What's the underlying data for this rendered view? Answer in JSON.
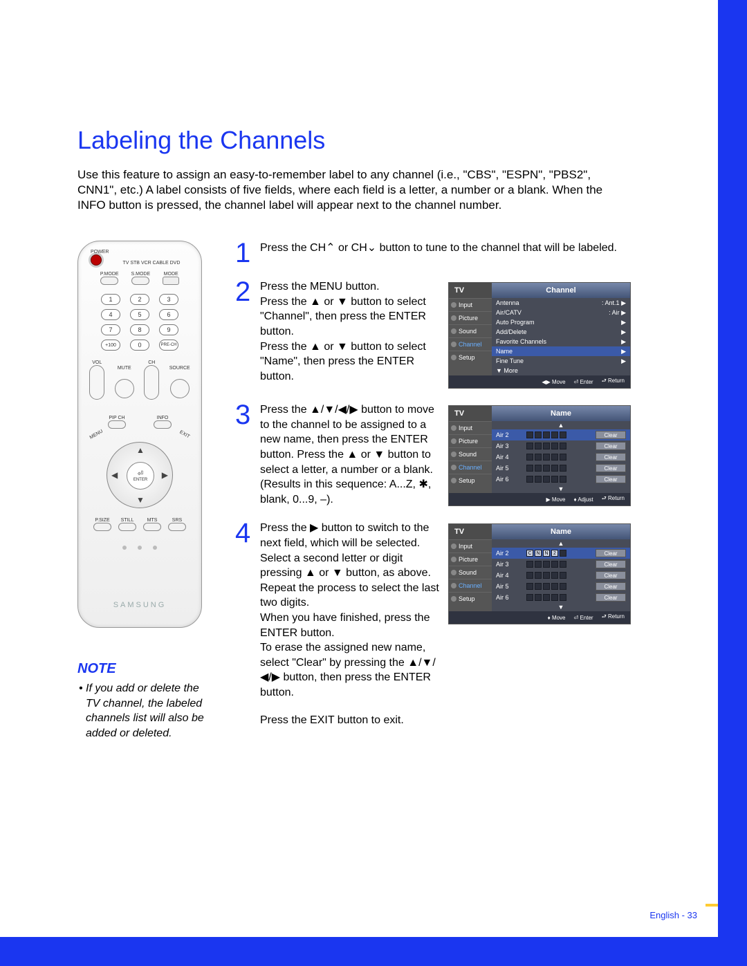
{
  "title": "Labeling the Channels",
  "intro": "Use this feature to assign an easy-to-remember label to any channel (i.e., \"CBS\", \"ESPN\", \"PBS2\", CNN1\", etc.) A label consists of five fields, where each field is a letter, a number or a blank. When the INFO button is pressed, the channel label will appear next to the channel number.",
  "remote": {
    "power": "POWER",
    "modes": [
      "TV",
      "STB",
      "VCR",
      "CABLE",
      "DVD"
    ],
    "row_modebtn": [
      "P.MODE",
      "S.MODE",
      "MODE"
    ],
    "nums": [
      [
        "1",
        "2",
        "3"
      ],
      [
        "4",
        "5",
        "6"
      ],
      [
        "7",
        "8",
        "9"
      ],
      [
        "+100",
        "0",
        "PRE-CH"
      ]
    ],
    "voll": "VOL",
    "chl": "CH",
    "mute": "MUTE",
    "source": "SOURCE",
    "pipch": "PIP CH",
    "info": "INFO",
    "menu": "MENU",
    "exit": "EXIT",
    "enter": "ENTER",
    "bottom": [
      "P.SIZE",
      "STILL",
      "MTS",
      "SRS"
    ],
    "brand": "SAMSUNG"
  },
  "note_h": "NOTE",
  "note_b": "• If you add or delete the TV channel, the labeled channels list will also be added or deleted.",
  "steps": {
    "s1": "Press the CH⌃ or CH⌄ button to tune to the channel that will be labeled.",
    "s2": "Press the MENU button.\nPress the ▲ or ▼ button to select \"Channel\", then press the ENTER button.\nPress the ▲ or ▼ button to select \"Name\", then press the ENTER button.",
    "s3": "Press the ▲/▼/◀/▶ button to move to the channel to be assigned to a new name, then press the ENTER button. Press the ▲ or ▼ button to select a letter, a number or a blank. (Results in this sequence: A...Z, ✱, blank, 0...9, –).",
    "s4": "Press the ▶ button to switch to the next field, which will be selected.\nSelect a second letter or digit pressing ▲ or ▼ button, as above.\nRepeat the process to select the last two digits.\nWhen you have finished, press the ENTER button.\nTo erase the assigned new name, select \"Clear\" by pressing the ▲/▼/◀/▶ button, then press the ENTER button."
  },
  "final": "Press the EXIT button to exit.",
  "osd1": {
    "tv": "TV",
    "title": "Channel",
    "side": [
      "Input",
      "Picture",
      "Sound",
      "Channel",
      "Setup"
    ],
    "rows": [
      {
        "l": "Antenna",
        "r": ": Ant.1",
        "a": "▶"
      },
      {
        "l": "Air/CATV",
        "r": ": Air",
        "a": "▶"
      },
      {
        "l": "Auto Program",
        "r": "",
        "a": "▶"
      },
      {
        "l": "Add/Delete",
        "r": "",
        "a": "▶"
      },
      {
        "l": "Favorite Channels",
        "r": "",
        "a": "▶"
      },
      {
        "l": "Name",
        "r": "",
        "a": "▶",
        "hl": true
      },
      {
        "l": "Fine Tune",
        "r": "",
        "a": "▶"
      },
      {
        "l": "▼ More",
        "r": "",
        "a": ""
      }
    ],
    "foot": [
      "◀▶ Move",
      "⏎ Enter",
      "⮐ Return"
    ]
  },
  "osd2": {
    "tv": "TV",
    "title": "Name",
    "side": [
      "Input",
      "Picture",
      "Sound",
      "Channel",
      "Setup"
    ],
    "rows": [
      {
        "ch": "Air  2",
        "hl": true,
        "slots": [
          "",
          "",
          "",
          "",
          ""
        ],
        "clr": "Clear"
      },
      {
        "ch": "Air  3",
        "slots": [
          "",
          "",
          "",
          "",
          ""
        ],
        "clr": "Clear"
      },
      {
        "ch": "Air  4",
        "slots": [
          "",
          "",
          "",
          "",
          ""
        ],
        "clr": "Clear"
      },
      {
        "ch": "Air  5",
        "slots": [
          "",
          "",
          "",
          "",
          ""
        ],
        "clr": "Clear"
      },
      {
        "ch": "Air  6",
        "slots": [
          "",
          "",
          "",
          "",
          ""
        ],
        "clr": "Clear"
      }
    ],
    "foot": [
      "▶ Move",
      "♦ Adjust",
      "⮐ Return"
    ]
  },
  "osd3": {
    "tv": "TV",
    "title": "Name",
    "side": [
      "Input",
      "Picture",
      "Sound",
      "Channel",
      "Setup"
    ],
    "rows": [
      {
        "ch": "Air  2",
        "hl": true,
        "slots": [
          "C",
          "N",
          "N",
          "2",
          ""
        ],
        "clr": "Clear"
      },
      {
        "ch": "Air  3",
        "slots": [
          "",
          "",
          "",
          "",
          ""
        ],
        "clr": "Clear"
      },
      {
        "ch": "Air  4",
        "slots": [
          "",
          "",
          "",
          "",
          ""
        ],
        "clr": "Clear"
      },
      {
        "ch": "Air  5",
        "slots": [
          "",
          "",
          "",
          "",
          ""
        ],
        "clr": "Clear"
      },
      {
        "ch": "Air  6",
        "slots": [
          "",
          "",
          "",
          "",
          ""
        ],
        "clr": "Clear"
      }
    ],
    "foot": [
      "♦ Move",
      "⏎ Enter",
      "⮐ Return"
    ]
  },
  "pagenum_l": "English - ",
  "pagenum_n": "33"
}
